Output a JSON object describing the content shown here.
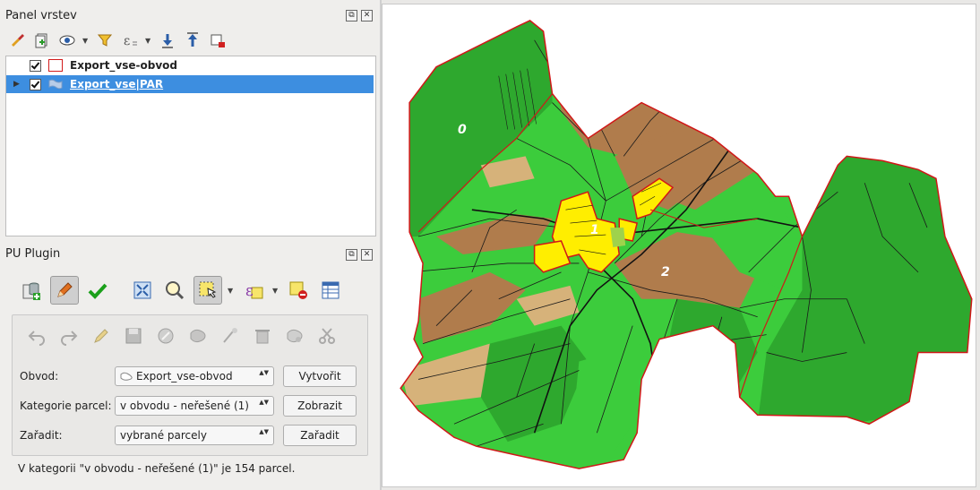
{
  "layers_panel": {
    "title": "Panel vrstev",
    "float_icon": "⧉",
    "close_icon": "✕",
    "layers": [
      {
        "name": "Export_vse-obvod",
        "checked": true,
        "symbol": "polygon-outline",
        "selected": false
      },
      {
        "name": "Export_vse|PAR",
        "checked": true,
        "symbol": "flag-icon",
        "selected": true,
        "expander": "▶"
      }
    ]
  },
  "pu_plugin": {
    "title": "PU Plugin",
    "float_icon": "⧉",
    "close_icon": "✕",
    "rows": [
      {
        "label": "Obvod:",
        "value": "Export_vse-obvod",
        "button": "Vytvořit"
      },
      {
        "label": "Kategorie parcel:",
        "value": "v obvodu - neřešené (1)",
        "button": "Zobrazit"
      },
      {
        "label": "Zařadit:",
        "value": "vybrané parcely",
        "button": "Zařadit"
      }
    ],
    "status": "V kategorii \"v obvodu - neřešené (1)\" je 154 parcel.",
    "spin_glyph": "▲▼",
    "dropdown_glyph": "▼"
  },
  "map": {
    "labels": [
      "0",
      "1",
      "2"
    ],
    "colors": {
      "dark_green": "#2ea82e",
      "light_green": "#3ccc3c",
      "brown": "#b07c4c",
      "tan": "#d6b27a",
      "yellow": "#ffee00",
      "boundary": "#d01818"
    }
  }
}
